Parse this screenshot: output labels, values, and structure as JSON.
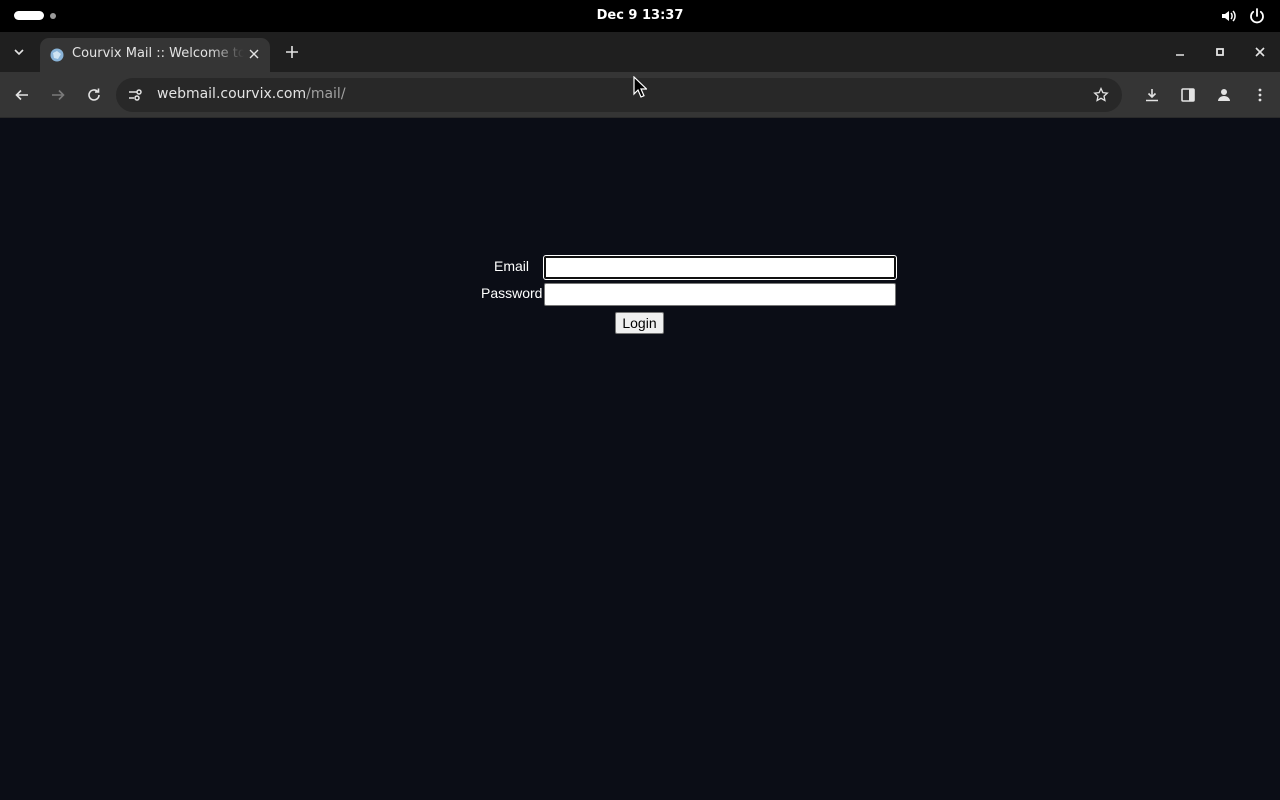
{
  "system": {
    "clock": "Dec 9  13:37"
  },
  "browser": {
    "tab": {
      "title": "Courvix Mail :: Welcome to Courvix Mail"
    },
    "address": {
      "host": "webmail.courvix.com",
      "path": "/mail/"
    }
  },
  "page": {
    "form": {
      "email_label": "Email",
      "email_value": "",
      "password_label": "Password",
      "password_value": "",
      "login_label": "Login"
    }
  },
  "colors": {
    "page_background": "#0b0d16",
    "chrome_toolbar": "#353535",
    "tabstrip": "#1f1f1f",
    "topbar": "#000000"
  },
  "icons": [
    "activities-icon",
    "volume-icon",
    "power-icon",
    "tab-list-icon",
    "favicon-icon",
    "close-tab-icon",
    "new-tab-icon",
    "minimize-icon",
    "maximize-icon",
    "close-window-icon",
    "back-icon",
    "forward-icon",
    "reload-icon",
    "site-info-icon",
    "bookmark-star-icon",
    "download-icon",
    "side-panel-icon",
    "profile-icon",
    "menu-icon",
    "mouse-cursor-icon"
  ]
}
